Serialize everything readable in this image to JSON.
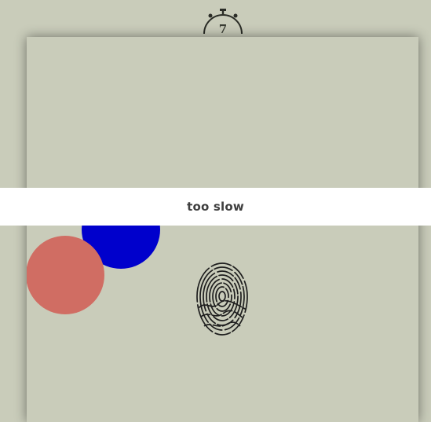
{
  "timer": {
    "icon": "stopwatch-icon",
    "value": "7"
  },
  "board": {
    "background_color": "#c9ccba",
    "targets": [
      {
        "name": "blue-circle",
        "color": "#0000cc"
      },
      {
        "name": "red-circle",
        "color": "#d06d63"
      }
    ],
    "center_icon": "fingerprint-icon"
  },
  "banner": {
    "message": "too slow"
  }
}
